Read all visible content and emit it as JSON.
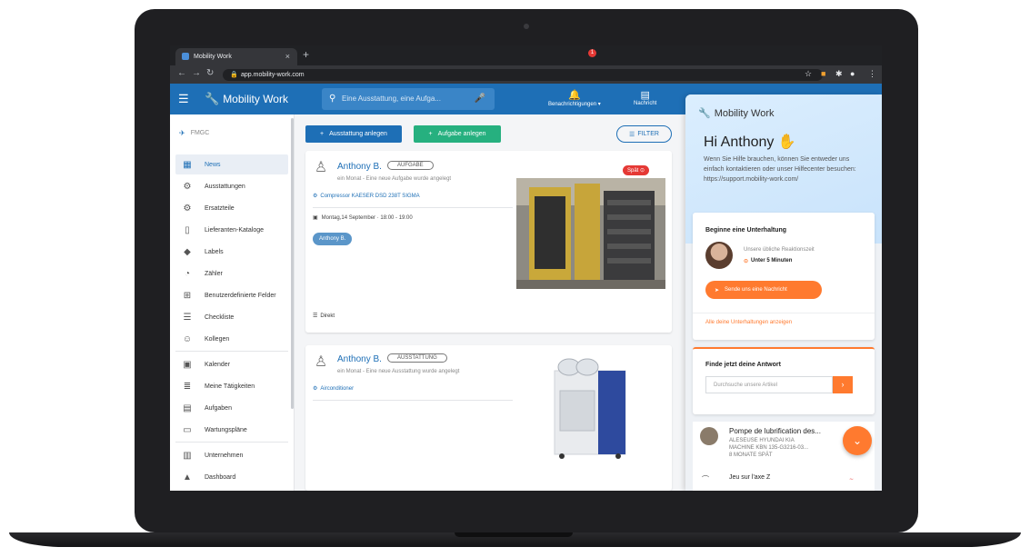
{
  "browser": {
    "tab_title": "Mobility Work",
    "url": "app.mobility-work.com"
  },
  "header": {
    "brand": "Mobility Work",
    "search_placeholder": "Eine Ausstattung, eine Aufga...",
    "notifications_label": "Benachrichtigungen",
    "notifications_count": "1",
    "messages_label": "Nachricht"
  },
  "sidebar": {
    "org_name": "FMGC",
    "items": [
      {
        "label": "News"
      },
      {
        "label": "Ausstattungen"
      },
      {
        "label": "Ersatzteile"
      },
      {
        "label": "Lieferanten-Kataloge"
      },
      {
        "label": "Labels"
      },
      {
        "label": "Zähler"
      },
      {
        "label": "Benutzerdefinierte Felder"
      },
      {
        "label": "Checkliste"
      },
      {
        "label": "Kollegen"
      },
      {
        "label": "Kalender"
      },
      {
        "label": "Meine Tätigkeiten"
      },
      {
        "label": "Aufgaben"
      },
      {
        "label": "Wartungspläne"
      },
      {
        "label": "Unternehmen"
      },
      {
        "label": "Dashboard"
      }
    ]
  },
  "toolbar": {
    "add_equipment": "Ausstattung anlegen",
    "add_task": "Aufgabe anlegen",
    "filter": "FILTER"
  },
  "posts": [
    {
      "user": "Anthony B.",
      "tag": "AUFGABE",
      "subtitle": "ein Monat - Eine neue Aufgabe wurde angelegt",
      "equipment": "Compressor KAESER DSD 238T SIGMA",
      "date": "Montag,14 September · 18:00 - 19:00",
      "assignee": "Anthony B.",
      "late": "Spät",
      "type": "Direkt"
    },
    {
      "user": "Anthony B.",
      "tag": "AUSSTATTUNG",
      "subtitle": "ein Monat - Eine neue Ausstattung wurde angelegt",
      "equipment": "Airconditioner"
    }
  ],
  "chat": {
    "brand": "Mobility Work",
    "greeting": "Hi Anthony",
    "help_text": "Wenn Sie Hilfe brauchen, können Sie entweder uns einfach kontaktieren oder unser Hilfecenter besuchen: https://support.mobility-work.com/",
    "conversation_title": "Beginne eine Unterhaltung",
    "response_label": "Unsere übliche Reaktionszeit",
    "response_time": "Unter 5 Minuten",
    "send_label": "Sende uns eine Nachricht",
    "all_conversations": "Alle deine Unterhaltungen anzeigen",
    "answer_title": "Finde jetzt deine Antwort",
    "article_placeholder": "Durchsuche unsere Artikel"
  },
  "feed": {
    "title": "Pompe de lubrification des...",
    "line1": "ALESEUSE HYUNDAI KIA",
    "line2": "MACHINE KBN 135-G3216-03...",
    "line3": "8 MONATE SPÄT",
    "item2": "Jeu sur l'axe Z"
  },
  "colors": {
    "primary": "#1e6fb6",
    "success": "#26b07f",
    "accent": "#ff7a2f",
    "danger": "#e53935"
  }
}
